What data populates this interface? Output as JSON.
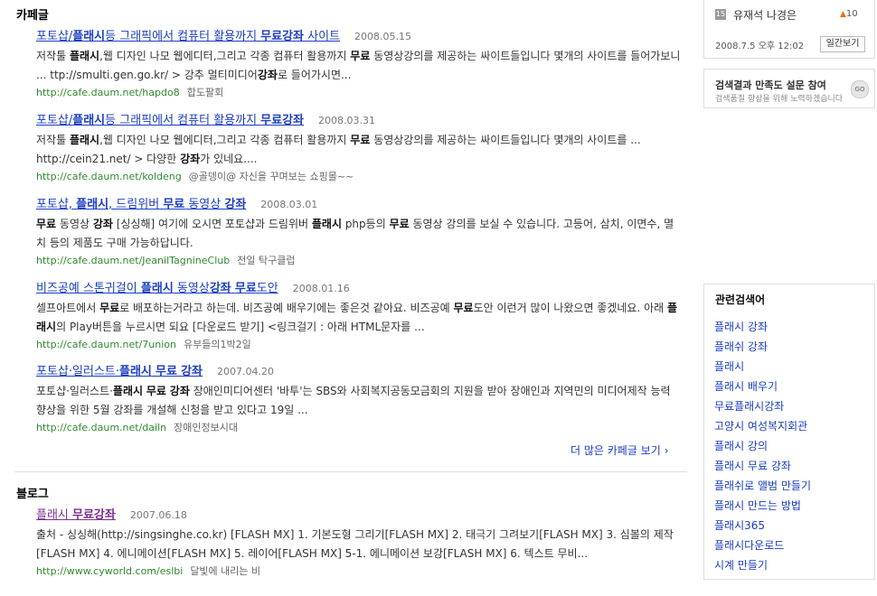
{
  "cafe": {
    "section_title": "카페글",
    "results": [
      {
        "title_parts": [
          [
            "포토샵/",
            false
          ],
          [
            "플래시",
            true
          ],
          [
            "등 그래픽에서 컴퓨터 활용까지 ",
            false
          ],
          [
            "무료강좌",
            true
          ],
          [
            " 사이트",
            false
          ]
        ],
        "date": "2008.05.15",
        "desc_parts": [
          [
            "저작툴 ",
            false
          ],
          [
            "플래시",
            true
          ],
          [
            ",웹 디자인 나모 웹에디터,그리고 각종 컴퓨터 활용까지 ",
            false
          ],
          [
            "무료",
            true
          ],
          [
            " 동영상강의를 제공하는 싸이트들입니다 몇개의 사이트를 들어가보니 ... ttp://smulti.gen.go.kr/ > 강추 멀티미디어",
            false
          ],
          [
            "강좌",
            true
          ],
          [
            "로 들어가시면...",
            false
          ]
        ],
        "url": "http://cafe.daum.net/hapdo8",
        "cafe_name": "합도팔회"
      },
      {
        "title_parts": [
          [
            "포토샵/",
            false
          ],
          [
            "플래시",
            true
          ],
          [
            "등 그래픽에서 컴퓨터 활용까지 ",
            false
          ],
          [
            "무료강좌",
            true
          ]
        ],
        "date": "2008.03.31",
        "desc_parts": [
          [
            "저작툴 ",
            false
          ],
          [
            "플래시",
            true
          ],
          [
            ",웹 디자인 나모 웹에디터,그리고 각종 컴퓨터 활용까지 ",
            false
          ],
          [
            "무료",
            true
          ],
          [
            " 동영상강의를 제공하는 싸이트들입니다 몇개의 사이트를 ... http://cein21.net/ > 다양한 ",
            false
          ],
          [
            "강좌",
            true
          ],
          [
            "가 있네요....",
            false
          ]
        ],
        "url": "http://cafe.daum.net/koldeng",
        "cafe_name": "@골뎅이@ 자신을 꾸며보는 쇼핑몰~~"
      },
      {
        "title_parts": [
          [
            "포토샵, ",
            false
          ],
          [
            "플래시",
            true
          ],
          [
            ", 드림위버 ",
            false
          ],
          [
            "무료",
            true
          ],
          [
            " 동영상 ",
            false
          ],
          [
            "강좌",
            true
          ]
        ],
        "date": "2008.03.01",
        "desc_parts": [
          [
            "무료",
            true
          ],
          [
            " 동영상 ",
            false
          ],
          [
            "강좌",
            true
          ],
          [
            " [싱싱해] 여기에 오시면 포토샵과 드림위버 ",
            false
          ],
          [
            "플래시",
            true
          ],
          [
            " php등의 ",
            false
          ],
          [
            "무료",
            true
          ],
          [
            " 동영상 강의를 보실 수 있습니다. 고등어, 삼치, 이면수, 멸치 등의 제품도 구매 가능하답니다.",
            false
          ]
        ],
        "url": "http://cafe.daum.net/JeanilTagnineClub",
        "cafe_name": "전일 탁구클럽"
      },
      {
        "title_parts": [
          [
            "비즈공예 스톤귀걸이 ",
            false
          ],
          [
            "플래시",
            true
          ],
          [
            " 동영상",
            false
          ],
          [
            "강좌",
            true
          ],
          [
            " ",
            false
          ],
          [
            "무료",
            true
          ],
          [
            "도안",
            false
          ]
        ],
        "date": "2008.01.16",
        "desc_parts": [
          [
            "셀프아트에서 ",
            false
          ],
          [
            "무료",
            true
          ],
          [
            "로 배포하는거라고 하는데. 비즈공예 배우기에는 좋은것 같아요. 비즈공예 ",
            false
          ],
          [
            "무료",
            true
          ],
          [
            "도안 이런거 많이 나왔으면 좋겠네요. 아래 ",
            false
          ],
          [
            "플래시",
            true
          ],
          [
            "의 Play버튼을 누르시면 되요 [다운로드 받기] <링크걸기 : 아래 HTML문자를 ...",
            false
          ]
        ],
        "url": "http://cafe.daum.net/7union",
        "cafe_name": "유부들의1박2일"
      },
      {
        "title_parts": [
          [
            "포토샵·일러스트·",
            false
          ],
          [
            "플래시",
            true
          ],
          [
            " ",
            false
          ],
          [
            "무료",
            true
          ],
          [
            " ",
            false
          ],
          [
            "강좌",
            true
          ]
        ],
        "date": "2007.04.20",
        "desc_parts": [
          [
            "포토샵·일러스트·",
            false
          ],
          [
            "플래시",
            true
          ],
          [
            " ",
            false
          ],
          [
            "무료",
            true
          ],
          [
            " ",
            false
          ],
          [
            "강좌",
            true
          ],
          [
            " 장애인미디어센터 '바투'는 SBS와 사회복지공동모금회의 지원을 받아 장애인과 지역민의 미디어제작 능력 향상을 위한 5월 강좌를 개설해 신청을 받고 있다고 19일 ...",
            false
          ]
        ],
        "url": "http://cafe.daum.net/dailn",
        "cafe_name": "장애인정보시대"
      }
    ],
    "more_label": "더 많은 카페글 보기",
    "more_arrow": "›"
  },
  "blog": {
    "section_title": "블로그",
    "results": [
      {
        "title_parts": [
          [
            "플래시 ",
            false
          ],
          [
            "무료강좌",
            true
          ]
        ],
        "date": "2007.06.18",
        "desc_parts": [
          [
            "출처 - 싱싱해(http://singsinghe.co.kr) [FLASH MX] 1. 기본도형 그리기[FLASH MX] 2. 태극기 그려보기[FLASH MX] 3. 심볼의 제작[FLASH MX] 4. 에니메이션[FLASH MX] 5. 레이어[FLASH MX] 5-1. 에니메이션 보강[FLASH MX] 6. 텍스트 무비...",
            false
          ]
        ],
        "url": "http://www.cyworld.com/eslbi",
        "cafe_name": "달빛에 내리는 비"
      }
    ]
  },
  "sidebar": {
    "rank": {
      "number": "15",
      "name": "유재석 나경은",
      "change": "10"
    },
    "timestamp": "2008.7.5 오후 12:02",
    "week_button": "일간보기",
    "survey": {
      "title": "검색결과 만족도 설문 참여",
      "subtitle": "검색품질 향상을 위해 노력하겠습니다",
      "go": "GO"
    },
    "related": {
      "title": "관련검색어",
      "items": [
        "플래시 강좌",
        "플래쉬 강좌",
        "플래시",
        "플래시 배우기",
        "무료플래시강좌",
        "고양시 여성복지회관",
        "플래시 강의",
        "플래시 무료 강좌",
        "플래쉬로 앨범 만들기",
        "플래시 만드는 방법",
        "플래시365",
        "플래시다운로드",
        "시계 만들기"
      ]
    }
  },
  "colors": {
    "link": "#1a3dc1",
    "visited": "#7b2d8e",
    "url": "#2f8a2f",
    "up_arrow": "#f26c1a"
  }
}
